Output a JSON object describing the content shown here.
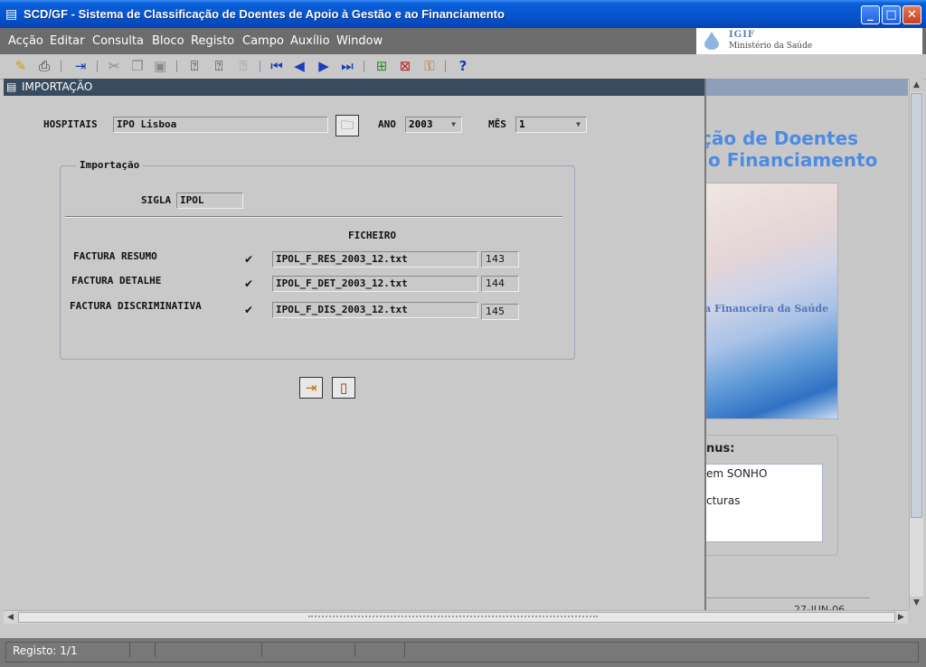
{
  "window": {
    "title": "SCD/GF - Sistema de Classificação de Doentes de Apoio à Gestão e ao Financiamento",
    "icon": "app-icon"
  },
  "menu": [
    "Acção",
    "Editar",
    "Consulta",
    "Bloco",
    "Registo",
    "Campo",
    "Auxílio",
    "Window"
  ],
  "logo": {
    "name": "IGIF",
    "subtitle": "Ministério da Saúde"
  },
  "toolbar_icons": [
    "save-icon",
    "print-icon",
    "exit-icon",
    "cut-icon",
    "copy-icon",
    "paste-icon",
    "enter-query-icon",
    "execute-query-icon",
    "cancel-query-icon",
    "first-record-icon",
    "previous-record-icon",
    "next-record-icon",
    "last-record-icon",
    "insert-record-icon",
    "delete-record-icon",
    "lock-record-icon",
    "help-icon"
  ],
  "background": {
    "line1": "ção de Doentes",
    "line2": "o Financiamento",
    "photo_caption": "a Financeira da Saúde",
    "menus_title": "nus:",
    "menu_items": [
      "em SONHO",
      "cturas"
    ],
    "date": "27-JUN-06"
  },
  "form": {
    "title": "IMPORTAÇÃO",
    "hospitais_label": "HOSPITAIS",
    "hospitais_value": "IPO Lisboa",
    "ano_label": "ANO",
    "ano_value": "2003",
    "mes_label": "MÊS",
    "mes_value": "1",
    "group_title": "Importação",
    "sigla_label": "SIGLA",
    "sigla_value": "IPOL",
    "ficheiro_header": "FICHEIRO",
    "rows": [
      {
        "label": "FACTURA RESUMO",
        "checked": true,
        "file": "IPOL_F_RES_2003_12.txt",
        "count": "143"
      },
      {
        "label": "FACTURA DETALHE",
        "checked": true,
        "file": "IPOL_F_DET_2003_12.txt",
        "count": "144"
      },
      {
        "label": "FACTURA DISCRIMINATIVA",
        "checked": true,
        "file": "IPOL_F_DIS_2003_12.txt",
        "count": "145"
      }
    ]
  },
  "status": {
    "record": "Registo: 1/1"
  }
}
